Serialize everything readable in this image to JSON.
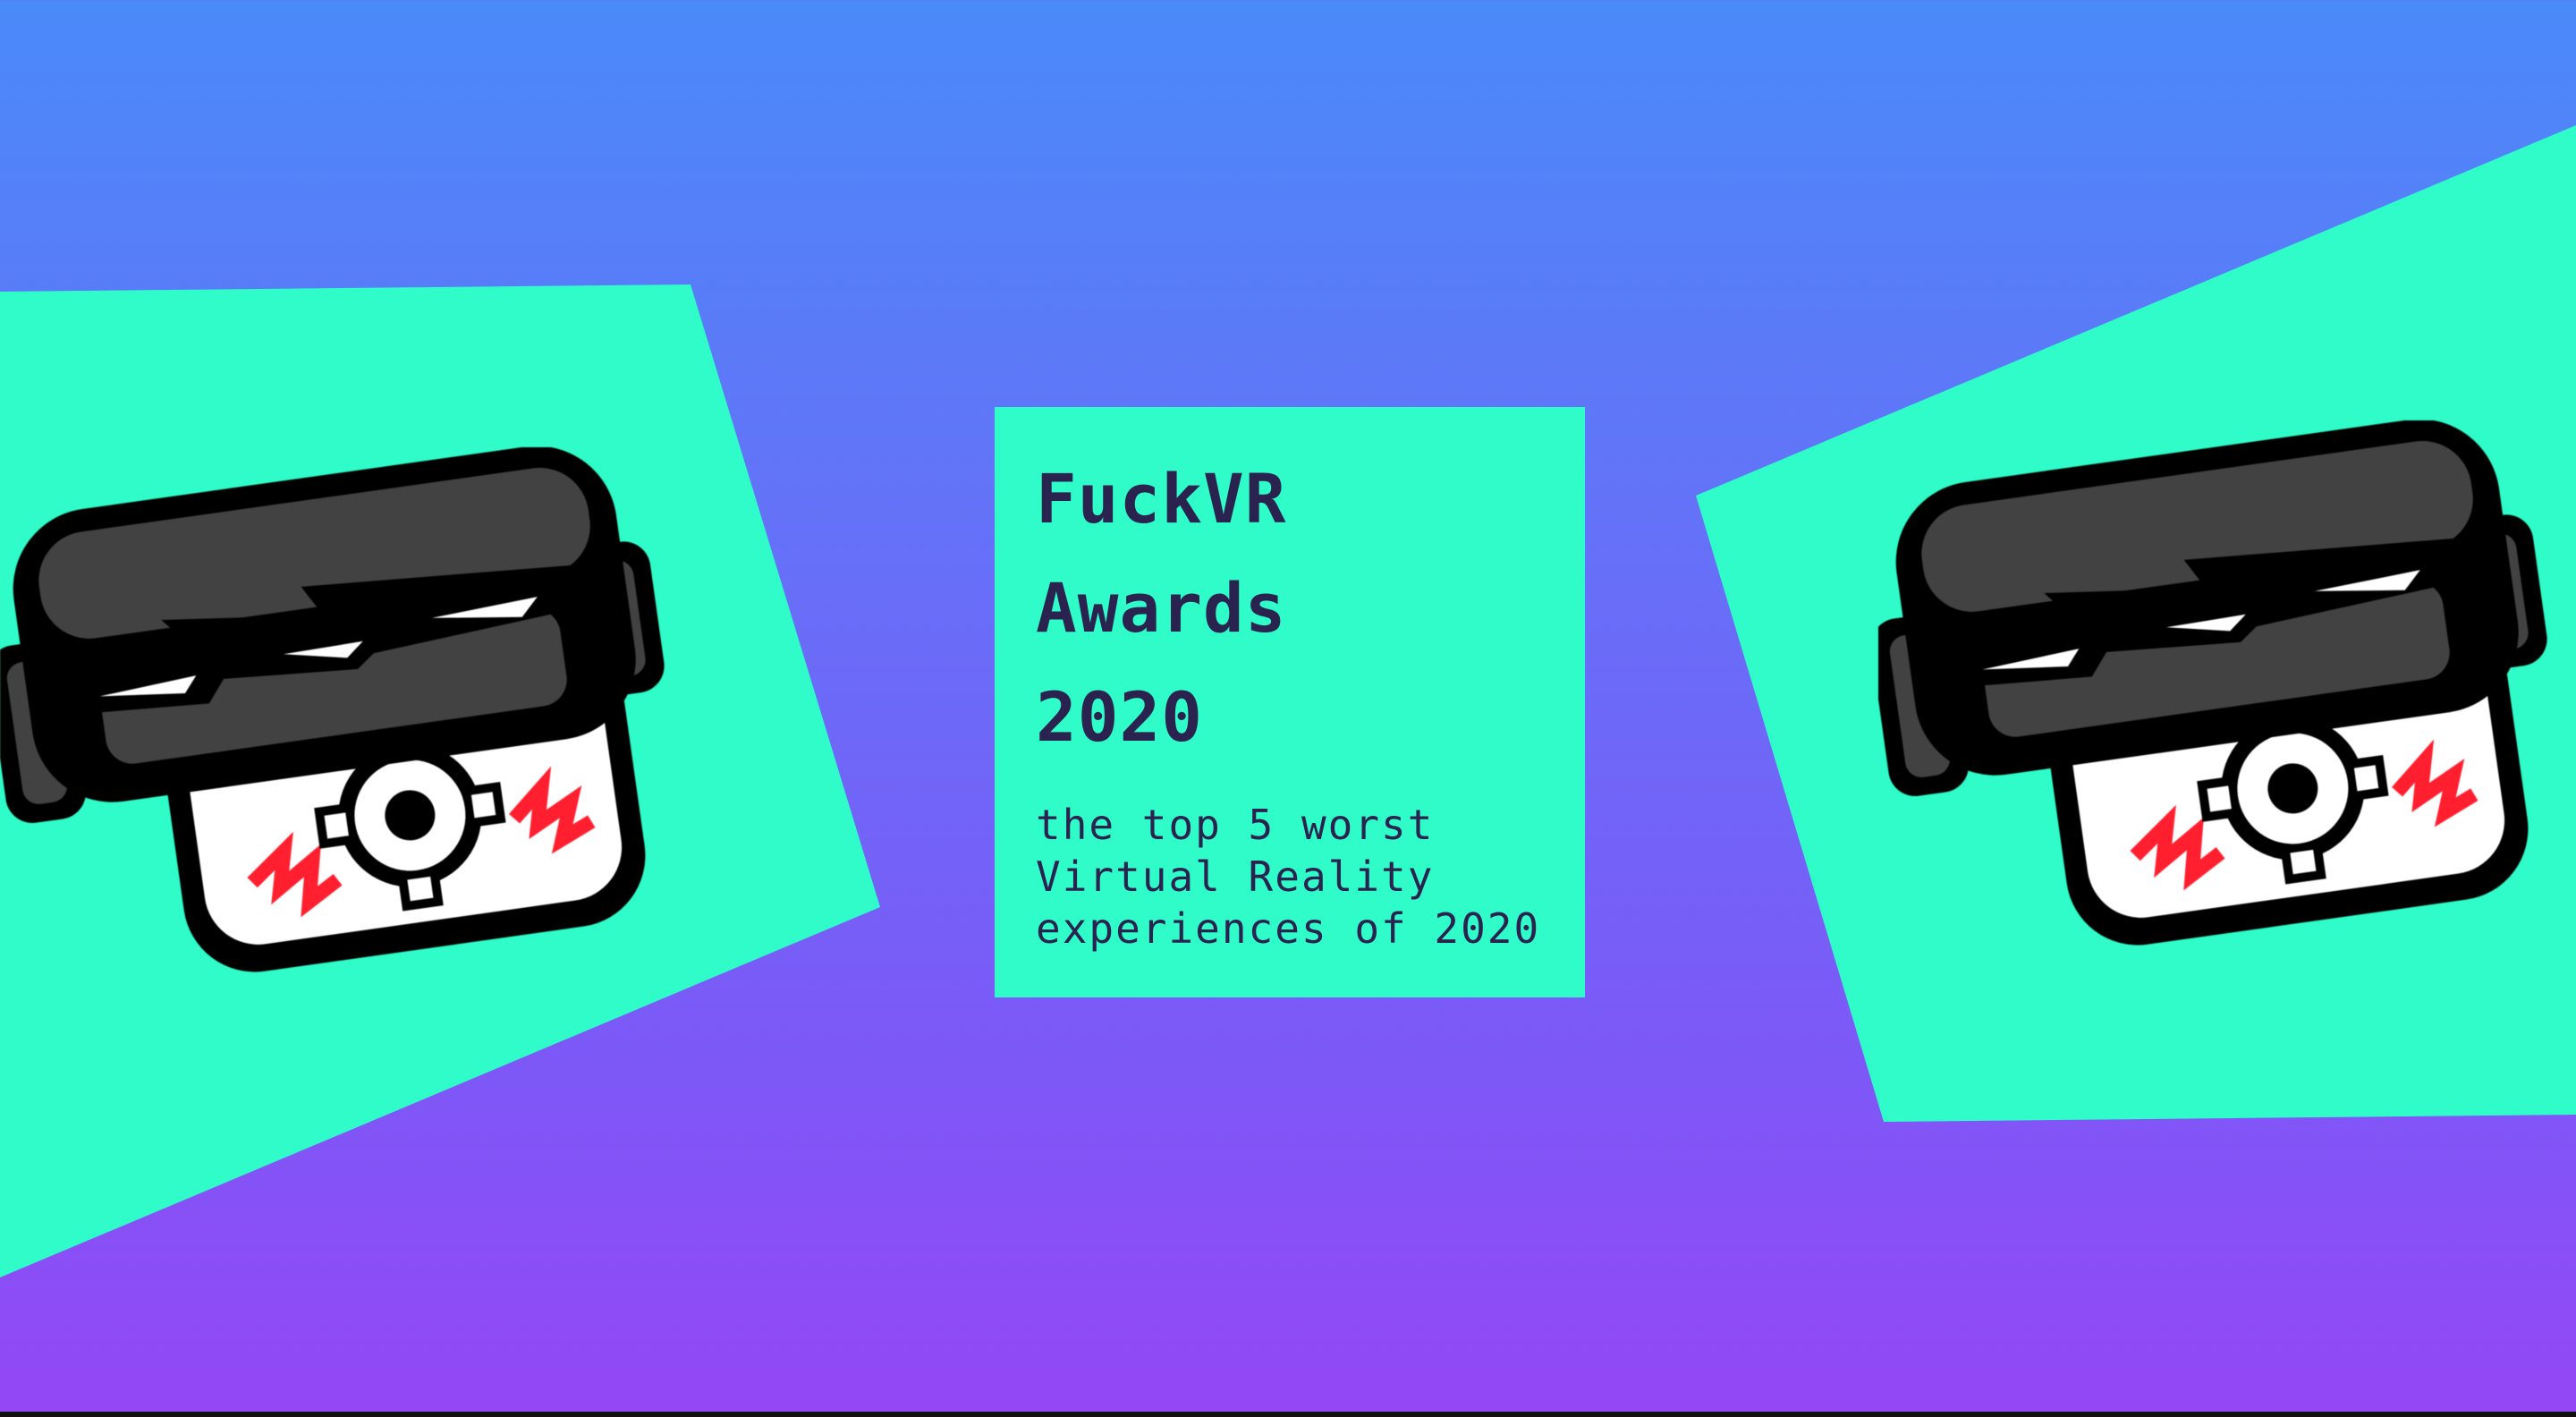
{
  "hero": {
    "title_lines": [
      "FuckVR",
      "Awards",
      "2020"
    ],
    "subtitle_lines": [
      "the top 5 worst",
      "Virtual Reality",
      "experiences of 2020"
    ]
  },
  "colors": {
    "background_top": "#4a8af9",
    "background_bottom": "#9447f5",
    "panel": "#2ffcc8",
    "text": "#2a2350",
    "mascot_dark": "#424242",
    "mascot_outline": "#000000",
    "mascot_accent": "#ff1f2f",
    "mascot_white": "#ffffff"
  },
  "mascots": [
    {
      "name": "broken-vr-headset-mascot-left",
      "icon": "vr-headset-icon"
    },
    {
      "name": "broken-vr-headset-mascot-right",
      "icon": "vr-headset-icon"
    }
  ]
}
